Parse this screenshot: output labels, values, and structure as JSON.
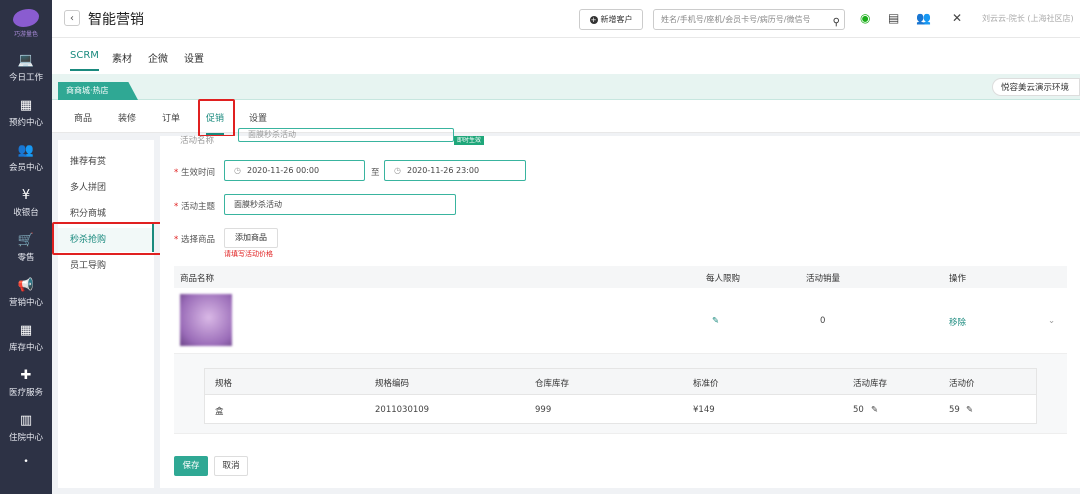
{
  "sidebar": {
    "logo_text": "巧游量色",
    "items": [
      {
        "label": "今日工作",
        "icon": "laptop-icon",
        "glyph": "💻"
      },
      {
        "label": "预约中心",
        "icon": "calendar-icon",
        "glyph": "▦"
      },
      {
        "label": "会员中心",
        "icon": "users-icon",
        "glyph": "👥"
      },
      {
        "label": "收银台",
        "icon": "yen-icon",
        "glyph": "¥"
      },
      {
        "label": "零售",
        "icon": "cart-icon",
        "glyph": "🛒"
      },
      {
        "label": "营销中心",
        "icon": "megaphone-icon",
        "glyph": "📢"
      },
      {
        "label": "库存中心",
        "icon": "grid-icon",
        "glyph": "▦"
      },
      {
        "label": "医疗服务",
        "icon": "medkit-icon",
        "glyph": "✚"
      },
      {
        "label": "住院中心",
        "icon": "building-icon",
        "glyph": "▥"
      }
    ],
    "more_glyph": "•"
  },
  "header": {
    "back_glyph": "‹",
    "title": "智能营销",
    "new_customer_label": "新增客户",
    "search_placeholder": "姓名/手机号/座机/会员卡号/病历号/微信号",
    "user_text": "刘云云-院长 (上海社区店)"
  },
  "top_tabs": [
    "SCRM",
    "素材",
    "企微",
    "设置"
  ],
  "store": {
    "name": "商商城·热店",
    "env": "悦容美云演示环境"
  },
  "sub_tabs": [
    "商品",
    "装修",
    "订单",
    "促销",
    "设置"
  ],
  "promo_menu": [
    "推荐有赏",
    "多人拼团",
    "积分商城",
    "秒杀抢购",
    "员工导购"
  ],
  "form": {
    "top_field_partial": "活动名称",
    "top_input_partial": "面膜秒杀活动",
    "badge": "即时生效",
    "valid_label": "生效时间",
    "start_time": "2020-11-26 00:00",
    "to": "至",
    "end_time": "2020-11-26 23:00",
    "theme_label": "活动主题",
    "theme_value": "面膜秒杀活动",
    "select_label": "选择商品",
    "add_product": "添加商品",
    "error": "请填写活动价格",
    "required_mark": "*"
  },
  "product_table": {
    "headers": [
      "商品名称",
      "每人限购",
      "活动销量",
      "操作"
    ],
    "row": {
      "limit_icon": "✎",
      "sales": "0",
      "action": "移除",
      "expand": "⌄"
    }
  },
  "spec_table": {
    "headers": [
      "规格",
      "规格编码",
      "仓库库存",
      "标准价",
      "活动库存",
      "活动价"
    ],
    "row": [
      "盒",
      "2011030109",
      "999",
      "¥149",
      "50",
      "59"
    ],
    "edit_glyph": "✎"
  },
  "buttons": {
    "save": "保存",
    "cancel": "取消"
  },
  "colors": {
    "accent": "#1a8a7e",
    "sidebar": "#2d3245",
    "highlight": "#e02020"
  }
}
